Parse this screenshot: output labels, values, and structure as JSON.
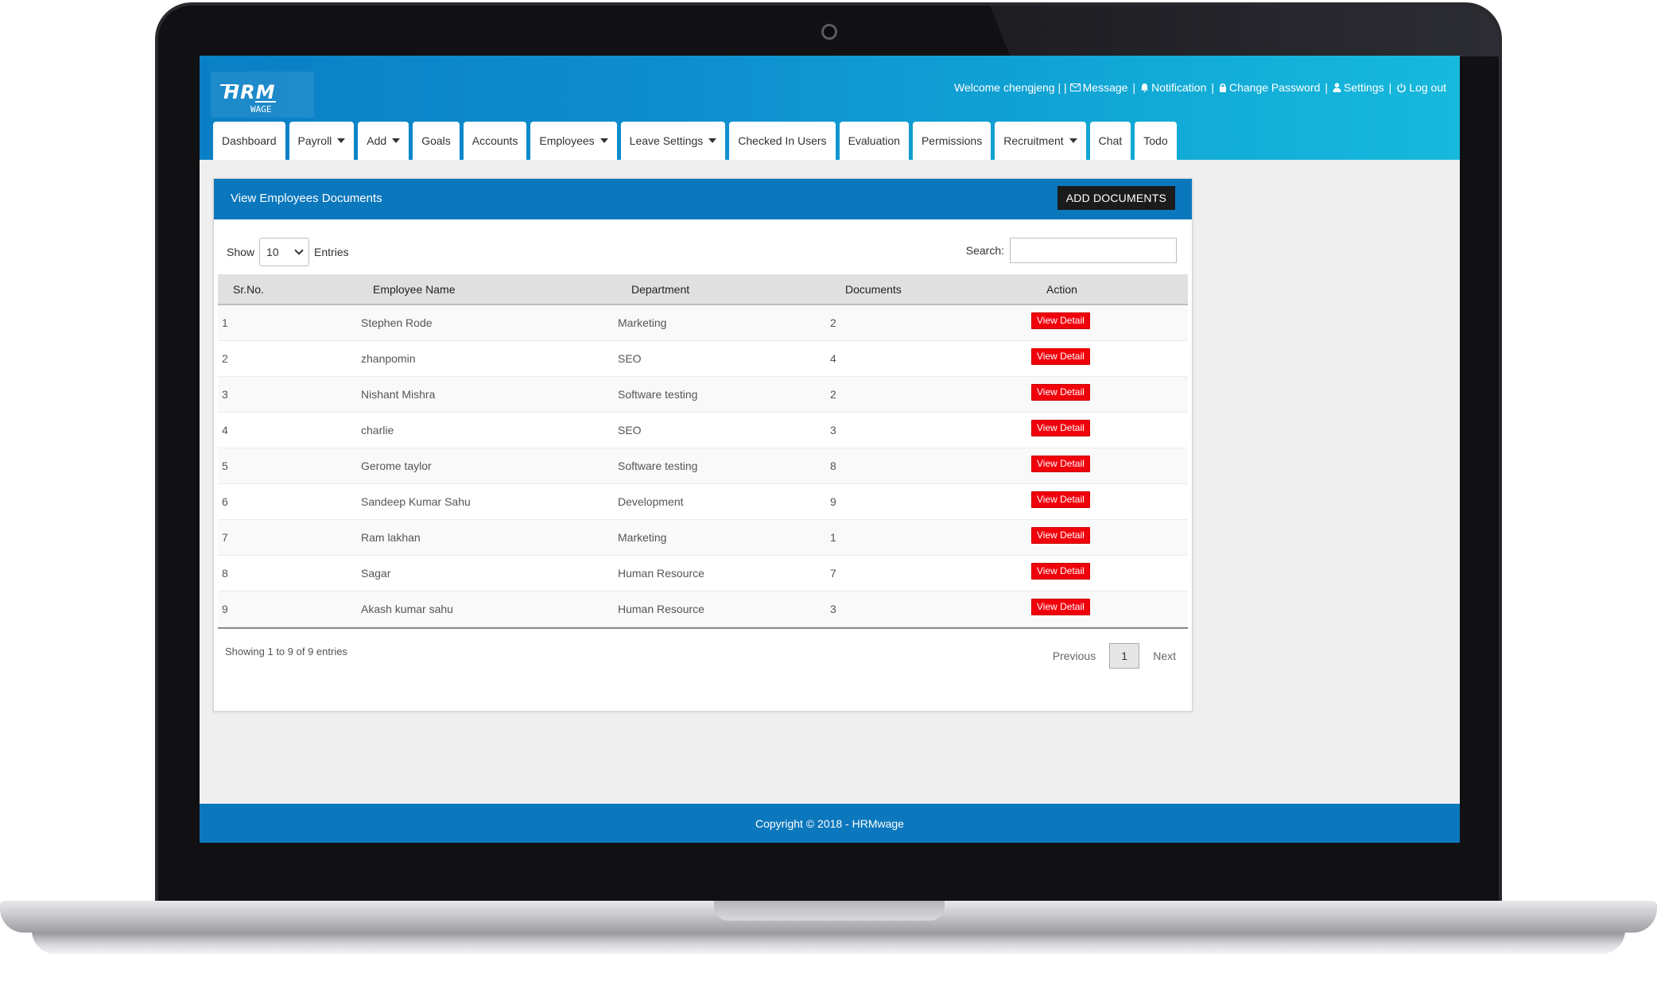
{
  "brand": {
    "logo_main": "HRM",
    "logo_sub": "WAGE"
  },
  "header": {
    "welcome": "Welcome chengjeng | |",
    "message": "Message",
    "notification": "Notification",
    "change_password": "Change Password",
    "settings": "Settings",
    "logout": "Log out",
    "separator": "|"
  },
  "nav": [
    {
      "label": "Dashboard",
      "dropdown": false
    },
    {
      "label": "Payroll",
      "dropdown": true
    },
    {
      "label": "Add",
      "dropdown": true
    },
    {
      "label": "Goals",
      "dropdown": false
    },
    {
      "label": "Accounts",
      "dropdown": false
    },
    {
      "label": "Employees",
      "dropdown": true
    },
    {
      "label": "Leave Settings",
      "dropdown": true
    },
    {
      "label": "Checked In Users",
      "dropdown": false
    },
    {
      "label": "Evaluation",
      "dropdown": false
    },
    {
      "label": "Permissions",
      "dropdown": false
    },
    {
      "label": "Recruitment",
      "dropdown": true
    },
    {
      "label": "Chat",
      "dropdown": false
    },
    {
      "label": "Todo",
      "dropdown": false
    }
  ],
  "panel": {
    "title": "View Employees Documents",
    "add_button": "ADD DOCUMENTS",
    "show_label": "Show",
    "entries_value": "10",
    "entries_label": "Entries",
    "search_label": "Search:",
    "search_value": ""
  },
  "table": {
    "headers": [
      "Sr.No.",
      "Employee Name",
      "Department",
      "Documents",
      "Action"
    ],
    "action_label": "View Detail",
    "rows": [
      {
        "sr": "1",
        "name": "Stephen Rode",
        "department": "Marketing",
        "documents": "2"
      },
      {
        "sr": "2",
        "name": "zhanpomin",
        "department": "SEO",
        "documents": "4"
      },
      {
        "sr": "3",
        "name": "Nishant Mishra",
        "department": "Software testing",
        "documents": "2"
      },
      {
        "sr": "4",
        "name": "charlie",
        "department": "SEO",
        "documents": "3"
      },
      {
        "sr": "5",
        "name": "Gerome taylor",
        "department": "Software testing",
        "documents": "8"
      },
      {
        "sr": "6",
        "name": "Sandeep Kumar Sahu",
        "department": "Development",
        "documents": "9"
      },
      {
        "sr": "7",
        "name": "Ram lakhan",
        "department": "Marketing",
        "documents": "1"
      },
      {
        "sr": "8",
        "name": "Sagar",
        "department": "Human Resource",
        "documents": "7"
      },
      {
        "sr": "9",
        "name": "Akash kumar sahu",
        "department": "Human Resource",
        "documents": "3"
      }
    ]
  },
  "pagination": {
    "info": "Showing 1 to 9 of 9 entries",
    "previous": "Previous",
    "current": "1",
    "next": "Next"
  },
  "footer": {
    "copyright": "Copyright © 2018 - HRMwage"
  },
  "colors": {
    "primary_blue": "#0b77bd",
    "header_gradient_end": "#17b9dc",
    "action_red": "#f1000b",
    "dark_button": "#1b1b1b"
  },
  "icons": {
    "message": "envelope-icon",
    "notification": "bell-icon",
    "change_password": "lock-icon",
    "settings": "user-icon",
    "logout": "power-icon"
  }
}
